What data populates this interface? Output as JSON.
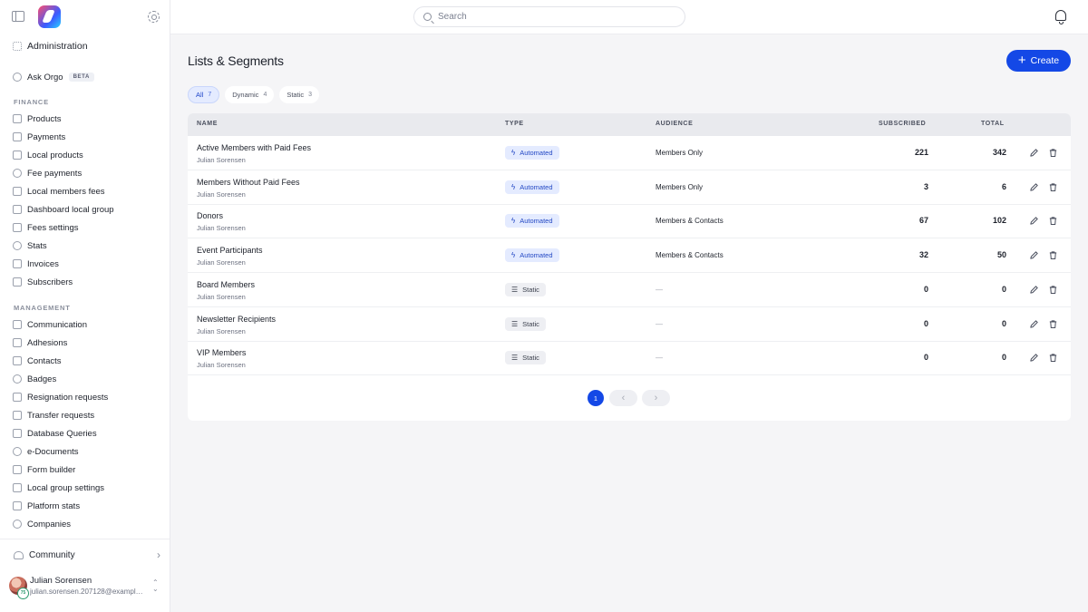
{
  "sidebar": {
    "admin_label": "Administration",
    "ask_label": "Ask Orgo",
    "beta_label": "BETA",
    "finance_label": "FINANCE",
    "finance_items": [
      "Products",
      "Payments",
      "Local products",
      "Fee payments",
      "Local members fees",
      "Dashboard local group",
      "Fees settings",
      "Stats",
      "Invoices",
      "Subscribers"
    ],
    "management_label": "MANAGEMENT",
    "management_items": [
      "Communication",
      "Adhesions",
      "Contacts",
      "Badges",
      "Resignation requests",
      "Transfer requests",
      "Database Queries",
      "e-Documents",
      "Form builder",
      "Local group settings",
      "Platform stats",
      "Companies"
    ],
    "community_label": "Community",
    "user": {
      "name": "Julian Sorensen",
      "email": "julian.sorensen.207128@example.com",
      "badge": "75"
    }
  },
  "topbar": {
    "search_placeholder": "Search"
  },
  "main": {
    "title": "Lists & Segments",
    "create_label": "Create",
    "filters": [
      {
        "label": "All",
        "count": "7",
        "active": true
      },
      {
        "label": "Dynamic",
        "count": "4",
        "active": false
      },
      {
        "label": "Static",
        "count": "3",
        "active": false
      }
    ],
    "columns": {
      "name": "NAME",
      "type": "TYPE",
      "audience": "AUDIENCE",
      "subscribed": "SUBSCRIBED",
      "total": "TOTAL"
    },
    "rows": [
      {
        "name": "Active Members with Paid Fees",
        "owner": "Julian Sorensen",
        "type": "Automated",
        "audience": "Members Only",
        "subscribed": "221",
        "total": "342"
      },
      {
        "name": "Members Without Paid Fees",
        "owner": "Julian Sorensen",
        "type": "Automated",
        "audience": "Members Only",
        "subscribed": "3",
        "total": "6"
      },
      {
        "name": "Donors",
        "owner": "Julian Sorensen",
        "type": "Automated",
        "audience": "Members & Contacts",
        "subscribed": "67",
        "total": "102"
      },
      {
        "name": "Event Participants",
        "owner": "Julian Sorensen",
        "type": "Automated",
        "audience": "Members & Contacts",
        "subscribed": "32",
        "total": "50"
      },
      {
        "name": "Board Members",
        "owner": "Julian Sorensen",
        "type": "Static",
        "audience": "—",
        "subscribed": "0",
        "total": "0"
      },
      {
        "name": "Newsletter Recipients",
        "owner": "Julian Sorensen",
        "type": "Static",
        "audience": "—",
        "subscribed": "0",
        "total": "0"
      },
      {
        "name": "VIP Members",
        "owner": "Julian Sorensen",
        "type": "Static",
        "audience": "—",
        "subscribed": "0",
        "total": "0"
      }
    ],
    "pagination": {
      "current_page": "1",
      "prev_icon": "‹",
      "next_icon": "›"
    }
  },
  "colors": {
    "accent": "#1448e6",
    "automated_bg": "#e4ebff",
    "static_bg": "#eeeff3"
  }
}
